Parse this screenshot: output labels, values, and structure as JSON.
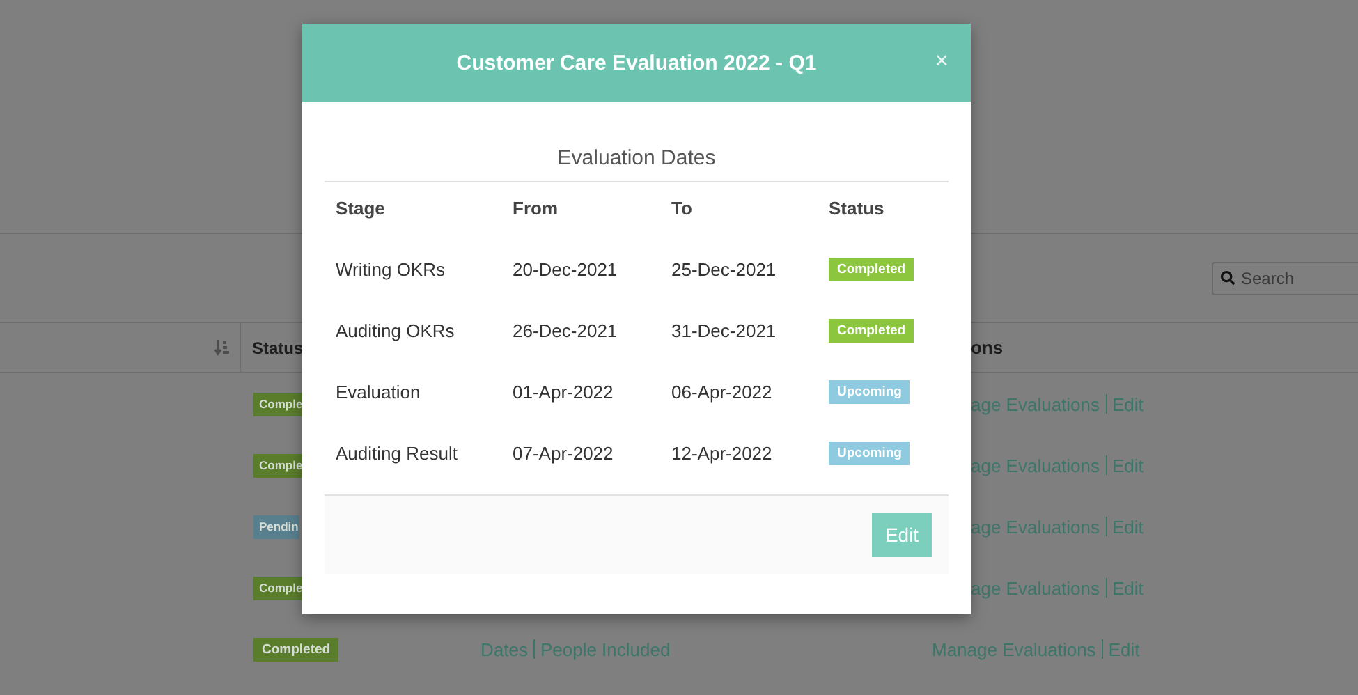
{
  "page": {
    "search": {
      "placeholder": "Search"
    },
    "table": {
      "columns": [
        "Status",
        "ons"
      ],
      "rows": [
        {
          "kind": "covered",
          "status": {
            "label": "Comple",
            "kind": "completed"
          },
          "actions": [
            "age Evaluations",
            "Edit"
          ]
        },
        {
          "kind": "covered",
          "status": {
            "label": "Comple",
            "kind": "completed"
          },
          "actions": [
            "age Evaluations",
            "Edit"
          ]
        },
        {
          "kind": "covered",
          "status": {
            "label": "Pendin",
            "kind": "pending"
          },
          "actions": [
            "age Evaluations",
            "Edit"
          ]
        },
        {
          "kind": "covered",
          "status": {
            "label": "Comple",
            "kind": "completed"
          },
          "actions": [
            "age Evaluations",
            "Edit"
          ]
        },
        {
          "kind": "full",
          "status": {
            "label": "Completed",
            "kind": "completed"
          },
          "links": [
            "Dates",
            "People Included"
          ],
          "actions": [
            "Manage Evaluations",
            "Edit"
          ]
        }
      ]
    }
  },
  "modal": {
    "title": "Customer Care Evaluation 2022 - Q1",
    "close": "×",
    "section_title": "Evaluation Dates",
    "columns": [
      "Stage",
      "From",
      "To",
      "Status"
    ],
    "rows": [
      {
        "stage": "Writing OKRs",
        "from": "20-Dec-2021",
        "to": "25-Dec-2021",
        "status": {
          "label": "Completed",
          "kind": "completed"
        }
      },
      {
        "stage": "Auditing OKRs",
        "from": "26-Dec-2021",
        "to": "31-Dec-2021",
        "status": {
          "label": "Completed",
          "kind": "completed"
        }
      },
      {
        "stage": "Evaluation",
        "from": "01-Apr-2022",
        "to": "06-Apr-2022",
        "status": {
          "label": "Upcoming",
          "kind": "upcoming"
        }
      },
      {
        "stage": "Auditing Result",
        "from": "07-Apr-2022",
        "to": "12-Apr-2022",
        "status": {
          "label": "Upcoming",
          "kind": "upcoming"
        }
      }
    ],
    "button": "Edit"
  }
}
